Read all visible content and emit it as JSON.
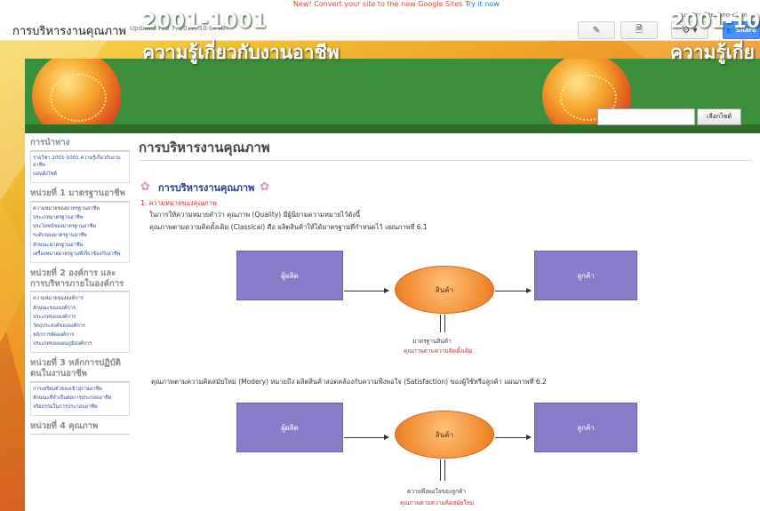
{
  "editor_bar": {
    "notice_prefix": "New! ",
    "notice_text": "Convert your site to the new Google Sites",
    "notice_link": "Try it now",
    "site_title": "การบริหารงานคุณภาพ",
    "updated": "Updated Feb 7, 2017, 10:07 AM",
    "user_email": "sumitra@techno-chon.ac",
    "edit_icon": "pencil-icon",
    "page_icon": "new-page-icon",
    "settings_icon": "gear-icon",
    "share_label": "Share"
  },
  "banner": {
    "course_code": "2001-1001",
    "course_name": "ความรู้เกี่ยวกับงานอาชีพ",
    "course_code_repeat": "2001-10",
    "course_name_repeat": "ความรู้เกี่ย",
    "search_button": "เลือกไซต์"
  },
  "sidebar": {
    "sections": [
      {
        "heading": "การนำทาง",
        "items": [
          "รายวิชา 2001-1001 ความรู้เกี่ยวกับงานอาชีพ",
          "แผนผังไซต์"
        ]
      },
      {
        "heading": "หน่วยที่ 1 มาตรฐานอาชีพ",
        "items": [
          "ความหมายของมาตรฐานอาชีพ",
          "ประเภทมาตรฐานอาชีพ",
          "ประโยชน์ของมาตรฐานอาชีพ",
          "ระดับของมาตรฐานอาชีพ",
          "ลักษณะมาตรฐานอาชีพ",
          "เครื่องหมายมาตรฐานที่เกี่ยวข้องกับอาชีพ"
        ]
      },
      {
        "heading": "หน่วยที่ 2 องค์การ และการบริหารภายในองค์การ",
        "items": [
          "ความหมายขององค์การ",
          "ลักษณะขององค์การ",
          "ประเภทขององค์การ",
          "วัตถุประสงค์ขององค์การ",
          "หลักการจัดองค์การ",
          "ประเภทของแผนภูมิองค์การ"
        ]
      },
      {
        "heading": "หน่วยที่ 3 หลักการปฏิบัติตนในงานอาชีพ",
        "items": [
          "การเตรียมตัวของเข้าสู่งานอาชีพ",
          "ลักษณะที่จำเป็นต่อการประกอบอาชีพ",
          "จริยธรรมในการประกอบอาชีพ"
        ]
      },
      {
        "heading": "หน่วยที่ 4 คุณภาพ",
        "items": []
      }
    ]
  },
  "main": {
    "page_title": "การบริหารงานคุณภาพ",
    "section_title": "การบริหารงานคุณภาพ",
    "point1": "1. ความหมายของคุณภาพ",
    "line1": "ในการให้ความหมายคำว่า คุณภาพ (Quality) มีผู้นิยามความหมายไว้ดังนี้",
    "line2": "คุณภาพตามความคิดดั้งเดิม (Classical) คือ ผลิตสินค้าให้ได้มาตรฐานที่กำหนดไว้ แผนภาพที่ 6.1",
    "diagram1": {
      "producer": "ผู้ผลิต",
      "product": "สินค้า",
      "customer": "ลูกค้า",
      "caption": "มาตรฐานสินค้า",
      "caption_red": "คุณภาพตามความคิดดั้งเดิม"
    },
    "line3": "คุณภาพตามความคิดสมัยใหม่ (Modery) หมายถึง ผลิตสินค้าสอดคล้องกับความพึงพอใจ (Satisfaction) ของผู้ใช้หรือลูกค้า แผนภาพที่ 6.2",
    "diagram2": {
      "producer": "ผู้ผลิต",
      "product": "สินค้า",
      "customer": "ลูกค้า",
      "caption": "ความพึงพอใจของลูกค้า",
      "caption_red": "คุณภาพตามความคิดสมัยใหม่"
    }
  },
  "colors": {
    "banner_green": "#3c8f3a",
    "box_purple": "#8b7cc9",
    "ellipse_orange": "#f28b30",
    "link_blue": "#2b4a8b",
    "accent_red": "#d32f2f"
  }
}
